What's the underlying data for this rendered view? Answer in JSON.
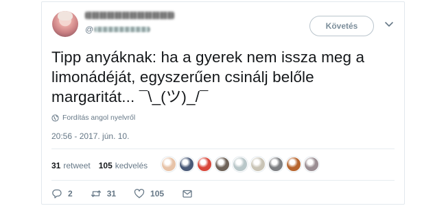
{
  "header": {
    "follow_label": "Követés",
    "handle_prefix": "@"
  },
  "tweet": {
    "lines": [
      "Tipp anyáknak: ha a gyerek nem issza meg a",
      "limonádéját, egyszerűen csinálj belőle",
      "margaritát... ¯\\_(ツ)_/¯"
    ],
    "translate_label": "Fordítás angol nyelvről",
    "timestamp": "20:56 - 2017. jún. 10."
  },
  "stats": {
    "retweets": "31",
    "retweets_label": "retweet",
    "likes": "105",
    "likes_label": "kedvelés"
  },
  "likers": [
    {
      "color": "#e7c3a8"
    },
    {
      "color": "#4a5a78"
    },
    {
      "color": "#d8473a"
    },
    {
      "color": "#6e6258"
    },
    {
      "color": "#b9c7c9"
    },
    {
      "color": "#c9c4b6"
    },
    {
      "color": "#7d7f82"
    },
    {
      "color": "#b7652e"
    },
    {
      "color": "#9a8e93"
    }
  ],
  "actions": {
    "reply_count": "2",
    "retweet_count": "31",
    "like_count": "105"
  },
  "icons": {
    "caret": "chevron-down-icon",
    "globe": "globe-icon",
    "reply": "reply-icon",
    "retweet": "retweet-icon",
    "like": "heart-icon",
    "dm": "direct-message-icon"
  }
}
